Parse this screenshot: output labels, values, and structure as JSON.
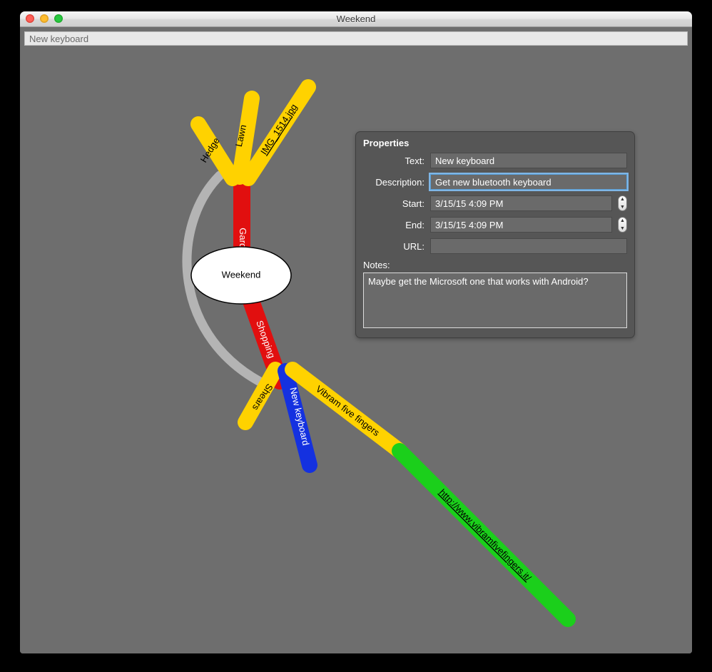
{
  "window": {
    "title": "Weekend"
  },
  "toolbar": {
    "search_value": "New keyboard"
  },
  "mindmap": {
    "root": {
      "label": "Weekend"
    },
    "branches": {
      "garden": {
        "label": "Garden",
        "children": {
          "hedge": {
            "label": "Hedge"
          },
          "lawn": {
            "label": "Lawn"
          },
          "img": {
            "label": "IMG_1514.jpg"
          }
        }
      },
      "shopping": {
        "label": "Shopping",
        "children": {
          "shears": {
            "label": "Shears"
          },
          "newkb": {
            "label": "New keyboard"
          },
          "vff": {
            "label": "Vibram five fingers",
            "url_label": "http://www.vibramfivefingers.it/"
          }
        }
      }
    }
  },
  "properties": {
    "panel_title": "Properties",
    "labels": {
      "text": "Text:",
      "description": "Description:",
      "start": "Start:",
      "end": "End:",
      "url": "URL:",
      "notes": "Notes:"
    },
    "values": {
      "text": "New keyboard",
      "description": "Get new bluetooth keyboard",
      "start": "3/15/15 4:09 PM",
      "end": "3/15/15 4:09 PM",
      "url": "",
      "notes": "Maybe get the Microsoft one that works with Android?"
    }
  },
  "colors": {
    "window_bg": "#6e6e6e",
    "branch_red": "#e10f0f",
    "branch_yellow": "#ffd200",
    "branch_blue": "#1431e0",
    "branch_green": "#1bcf1b",
    "root_fill": "#ffffff",
    "root_stroke": "#000000",
    "connector_grey": "#b4b4b4",
    "panel_bg": "#565656"
  }
}
